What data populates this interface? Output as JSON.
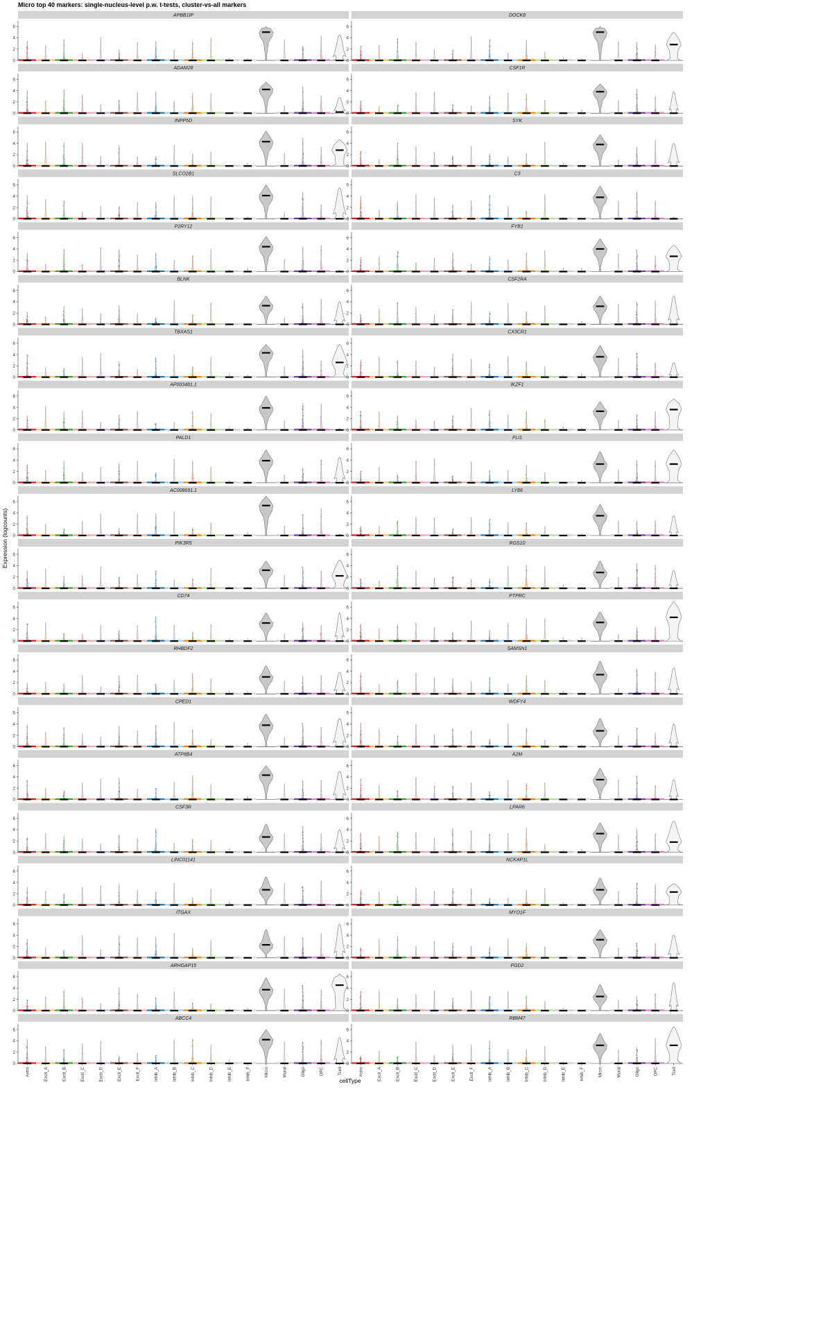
{
  "chart_data": {
    "type": "violin",
    "title": "Micro top 40 markers: single-nucleus-level p.w. t-tests, cluster-vs-all markers",
    "xlabel": "cellType",
    "ylabel": "Expression (logcounts)",
    "ylim": [
      0,
      7
    ],
    "yticks": [
      0,
      2,
      4,
      6
    ],
    "categories": [
      "Astro",
      "Excit_A",
      "Excit_B",
      "Excit_C",
      "Excit_D",
      "Excit_E",
      "Excit_F",
      "Inhib_A",
      "Inhib_B",
      "Inhib_C",
      "Inhib_D",
      "Inhib_E",
      "Inhib_F",
      "Micro",
      "Mural",
      "Oligo",
      "OPC",
      "Tcell"
    ],
    "colors": [
      "#e31a1c",
      "#fdbf6f",
      "#33a02c",
      "#fb9a99",
      "#cab2d6",
      "#8c564b",
      "#e5b5a3",
      "#1f78b4",
      "#a6cee3",
      "#ff7f00",
      "#b2df8a",
      "#cccccc",
      "#dddddd",
      "#bfbfbf",
      "#cccccc",
      "#6a3d9a",
      "#e377c2",
      "#eeeeee"
    ],
    "grid": false,
    "layout": "facet-wrap, 2 columns x 20 rows",
    "panels": [
      {
        "gene": "APBB1IP",
        "micro_median": 5.0,
        "micro_max": 6.0,
        "micro_width": 0.75,
        "tcell_median": 0,
        "tcell_max": 4.5,
        "tcell_width": 0.7
      },
      {
        "gene": "DOCK8",
        "micro_median": 5.0,
        "micro_max": 6.0,
        "micro_width": 0.75,
        "tcell_median": 2.8,
        "tcell_max": 5.0,
        "tcell_width": 0.8
      },
      {
        "gene": "ADAM28",
        "micro_median": 4.2,
        "micro_max": 5.5,
        "micro_width": 0.75,
        "tcell_median": 0.2,
        "tcell_max": 2.8,
        "tcell_width": 0.6
      },
      {
        "gene": "CSF1R",
        "micro_median": 3.8,
        "micro_max": 5.2,
        "micro_width": 0.75,
        "tcell_median": 0,
        "tcell_max": 3.8,
        "tcell_width": 0.5
      },
      {
        "gene": "INPP5D",
        "micro_median": 4.3,
        "micro_max": 6.2,
        "micro_width": 0.75,
        "tcell_median": 2.8,
        "tcell_max": 4.7,
        "tcell_width": 0.85
      },
      {
        "gene": "SYK",
        "micro_median": 3.8,
        "micro_max": 5.5,
        "micro_width": 0.75,
        "tcell_median": 0,
        "tcell_max": 4.0,
        "tcell_width": 0.6
      },
      {
        "gene": "SLCO2B1",
        "micro_median": 4.1,
        "micro_max": 6.0,
        "micro_width": 0.75,
        "tcell_median": 0,
        "tcell_max": 5.5,
        "tcell_width": 0.7
      },
      {
        "gene": "C3",
        "micro_median": 3.8,
        "micro_max": 5.8,
        "micro_width": 0.75,
        "tcell_median": 0,
        "tcell_max": 0.2,
        "tcell_width": 0.3
      },
      {
        "gene": "P2RY12",
        "micro_median": 4.4,
        "micro_max": 6.2,
        "micro_width": 0.75,
        "tcell_median": 0,
        "tcell_max": 0.2,
        "tcell_width": 0.3
      },
      {
        "gene": "FYB1",
        "micro_median": 4.0,
        "micro_max": 5.8,
        "micro_width": 0.75,
        "tcell_median": 2.7,
        "tcell_max": 4.7,
        "tcell_width": 0.85
      },
      {
        "gene": "BLNK",
        "micro_median": 3.3,
        "micro_max": 5.0,
        "micro_width": 0.75,
        "tcell_median": 0,
        "tcell_max": 4.0,
        "tcell_width": 0.6
      },
      {
        "gene": "CSF2RA",
        "micro_median": 3.2,
        "micro_max": 5.0,
        "micro_width": 0.75,
        "tcell_median": 0,
        "tcell_max": 5.0,
        "tcell_width": 0.6
      },
      {
        "gene": "TBXAS1",
        "micro_median": 4.3,
        "micro_max": 5.8,
        "micro_width": 0.75,
        "tcell_median": 2.6,
        "tcell_max": 5.8,
        "tcell_width": 0.85
      },
      {
        "gene": "CX3CR1",
        "micro_median": 3.6,
        "micro_max": 5.6,
        "micro_width": 0.75,
        "tcell_median": 0,
        "tcell_max": 2.5,
        "tcell_width": 0.5
      },
      {
        "gene": "AP003481.1",
        "micro_median": 3.9,
        "micro_max": 6.0,
        "micro_width": 0.75,
        "tcell_median": 0,
        "tcell_max": 0.2,
        "tcell_width": 0.3
      },
      {
        "gene": "IKZF1",
        "micro_median": 3.3,
        "micro_max": 5.0,
        "micro_width": 0.75,
        "tcell_median": 3.6,
        "tcell_max": 5.5,
        "tcell_width": 0.85
      },
      {
        "gene": "PALD1",
        "micro_median": 3.9,
        "micro_max": 5.8,
        "micro_width": 0.75,
        "tcell_median": 0,
        "tcell_max": 4.5,
        "tcell_width": 0.6
      },
      {
        "gene": "FLI1",
        "micro_median": 3.3,
        "micro_max": 5.5,
        "micro_width": 0.75,
        "tcell_median": 3.3,
        "tcell_max": 5.8,
        "tcell_width": 0.85
      },
      {
        "gene": "AC008691.1",
        "micro_median": 5.3,
        "micro_max": 7.0,
        "micro_width": 0.75,
        "tcell_median": 0,
        "tcell_max": 0.2,
        "tcell_width": 0.3
      },
      {
        "gene": "LY86",
        "micro_median": 3.5,
        "micro_max": 5.5,
        "micro_width": 0.75,
        "tcell_median": 0,
        "tcell_max": 3.5,
        "tcell_width": 0.5
      },
      {
        "gene": "PIK3R5",
        "micro_median": 3.2,
        "micro_max": 4.8,
        "micro_width": 0.75,
        "tcell_median": 2.2,
        "tcell_max": 5.0,
        "tcell_width": 0.85
      },
      {
        "gene": "RGS10",
        "micro_median": 2.8,
        "micro_max": 4.8,
        "micro_width": 0.75,
        "tcell_median": 0,
        "tcell_max": 3.2,
        "tcell_width": 0.5
      },
      {
        "gene": "CD74",
        "micro_median": 3.2,
        "micro_max": 5.0,
        "micro_width": 0.75,
        "tcell_median": 0,
        "tcell_max": 5.0,
        "tcell_width": 0.5
      },
      {
        "gene": "PTPRC",
        "micro_median": 3.3,
        "micro_max": 5.2,
        "micro_width": 0.75,
        "tcell_median": 4.2,
        "tcell_max": 7.0,
        "tcell_width": 0.85
      },
      {
        "gene": "RHBDF2",
        "micro_median": 3.0,
        "micro_max": 5.0,
        "micro_width": 0.75,
        "tcell_median": 0,
        "tcell_max": 3.8,
        "tcell_width": 0.6
      },
      {
        "gene": "SAMSN1",
        "micro_median": 3.4,
        "micro_max": 5.8,
        "micro_width": 0.75,
        "tcell_median": 0,
        "tcell_max": 4.6,
        "tcell_width": 0.6
      },
      {
        "gene": "CPED1",
        "micro_median": 3.8,
        "micro_max": 5.8,
        "micro_width": 0.75,
        "tcell_median": 0,
        "tcell_max": 5.0,
        "tcell_width": 0.7
      },
      {
        "gene": "WDFY4",
        "micro_median": 2.8,
        "micro_max": 5.0,
        "micro_width": 0.75,
        "tcell_median": 0,
        "tcell_max": 4.0,
        "tcell_width": 0.5
      },
      {
        "gene": "ATP8B4",
        "micro_median": 4.3,
        "micro_max": 6.0,
        "micro_width": 0.75,
        "tcell_median": 0,
        "tcell_max": 5.0,
        "tcell_width": 0.7
      },
      {
        "gene": "A2M",
        "micro_median": 3.5,
        "micro_max": 5.5,
        "micro_width": 0.75,
        "tcell_median": 0,
        "tcell_max": 3.5,
        "tcell_width": 0.5
      },
      {
        "gene": "CSF3R",
        "micro_median": 2.7,
        "micro_max": 5.0,
        "micro_width": 0.75,
        "tcell_median": 0,
        "tcell_max": 4.0,
        "tcell_width": 0.6
      },
      {
        "gene": "LPAR6",
        "micro_median": 3.3,
        "micro_max": 5.2,
        "micro_width": 0.75,
        "tcell_median": 1.8,
        "tcell_max": 5.5,
        "tcell_width": 0.85
      },
      {
        "gene": "LINC01141",
        "micro_median": 2.7,
        "micro_max": 5.0,
        "micro_width": 0.75,
        "tcell_median": 0,
        "tcell_max": 0.2,
        "tcell_width": 0.3
      },
      {
        "gene": "NCKAP1L",
        "micro_median": 2.7,
        "micro_max": 4.8,
        "micro_width": 0.75,
        "tcell_median": 2.3,
        "tcell_max": 3.8,
        "tcell_width": 0.85
      },
      {
        "gene": "ITGAX",
        "micro_median": 2.3,
        "micro_max": 5.0,
        "micro_width": 0.75,
        "tcell_median": 0,
        "tcell_max": 6.0,
        "tcell_width": 0.6
      },
      {
        "gene": "MYO1F",
        "micro_median": 3.2,
        "micro_max": 5.0,
        "micro_width": 0.75,
        "tcell_median": 0,
        "tcell_max": 4.0,
        "tcell_width": 0.6
      },
      {
        "gene": "ARHGAP15",
        "micro_median": 3.7,
        "micro_max": 5.8,
        "micro_width": 0.75,
        "tcell_median": 4.5,
        "tcell_max": 6.5,
        "tcell_width": 0.85
      },
      {
        "gene": "FGD2",
        "micro_median": 2.5,
        "micro_max": 4.6,
        "micro_width": 0.75,
        "tcell_median": 0,
        "tcell_max": 5.0,
        "tcell_width": 0.5
      },
      {
        "gene": "ABCC4",
        "micro_median": 4.2,
        "micro_max": 6.0,
        "micro_width": 0.75,
        "tcell_median": 0,
        "tcell_max": 4.6,
        "tcell_width": 0.6
      },
      {
        "gene": "RBM47",
        "micro_median": 3.2,
        "micro_max": 5.3,
        "micro_width": 0.75,
        "tcell_median": 3.2,
        "tcell_max": 6.5,
        "tcell_width": 0.85
      }
    ]
  }
}
